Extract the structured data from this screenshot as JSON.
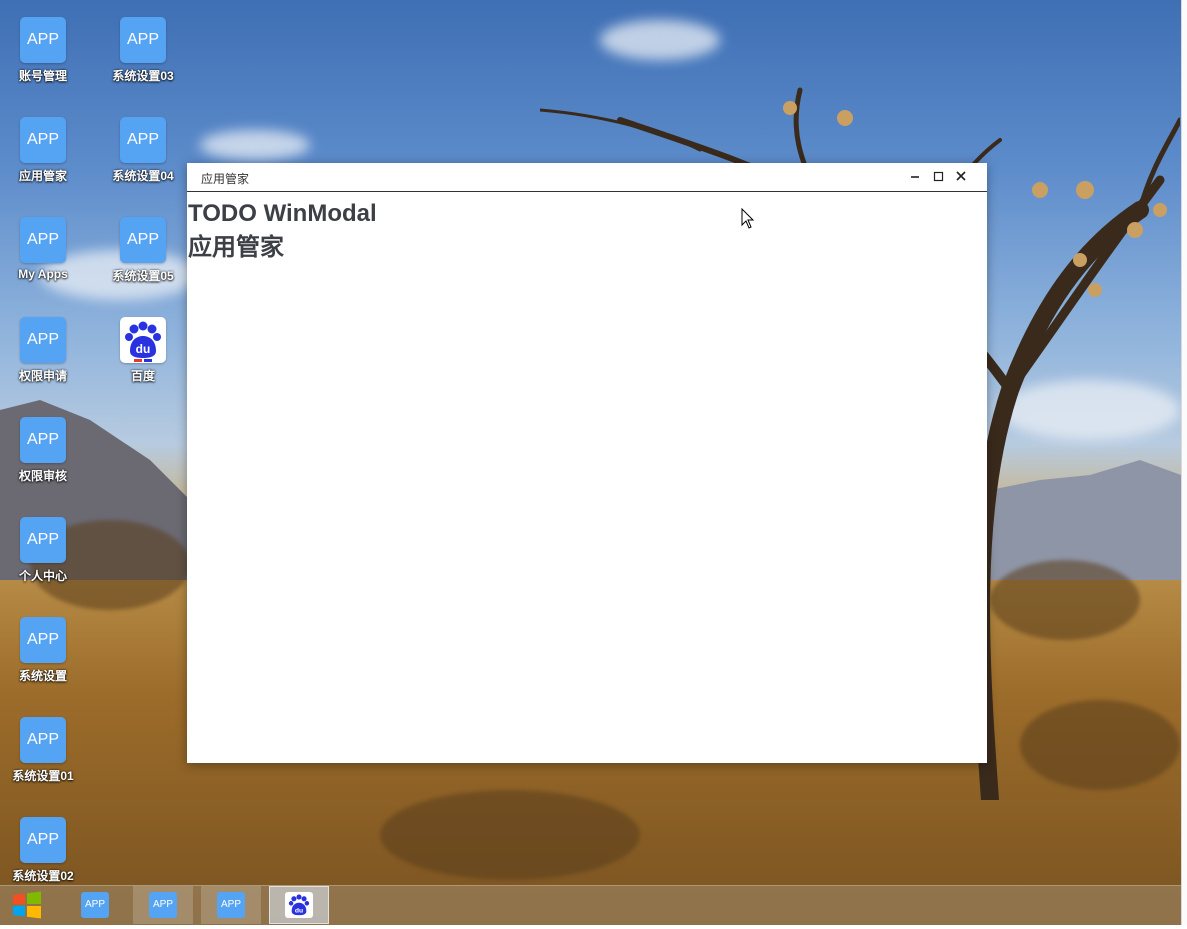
{
  "desktop": {
    "icons": [
      {
        "tile": "APP",
        "label": "账号管理"
      },
      {
        "tile": "APP",
        "label": "应用管家"
      },
      {
        "tile": "APP",
        "label": "My Apps"
      },
      {
        "tile": "APP",
        "label": "权限申请"
      },
      {
        "tile": "APP",
        "label": "权限审核"
      },
      {
        "tile": "APP",
        "label": "个人中心"
      },
      {
        "tile": "APP",
        "label": "系统设置"
      },
      {
        "tile": "APP",
        "label": "系统设置01"
      },
      {
        "tile": "APP",
        "label": "系统设置02"
      },
      {
        "tile": "APP",
        "label": "系统设置03"
      },
      {
        "tile": "APP",
        "label": "系统设置04"
      },
      {
        "tile": "APP",
        "label": "系统设置05"
      },
      {
        "tile": "du",
        "label": "百度",
        "icon": "baidu-paw-icon"
      }
    ]
  },
  "window": {
    "title": "应用管家",
    "heading1": "TODO WinModal",
    "heading2": "应用管家",
    "controls": [
      "minimize-icon",
      "maximize-icon",
      "close-icon"
    ]
  },
  "taskbar": {
    "start_icon": "windows-logo-icon",
    "items": [
      {
        "label": "APP",
        "state": "normal"
      },
      {
        "label": "APP",
        "state": "active"
      },
      {
        "label": "APP",
        "state": "active"
      },
      {
        "label": "du",
        "state": "focused",
        "icon": "baidu-paw-icon"
      }
    ]
  },
  "colors": {
    "app_tile": "#55a3f3",
    "baidu_blue": "#2932e1",
    "window_text": "#3c3f45"
  }
}
